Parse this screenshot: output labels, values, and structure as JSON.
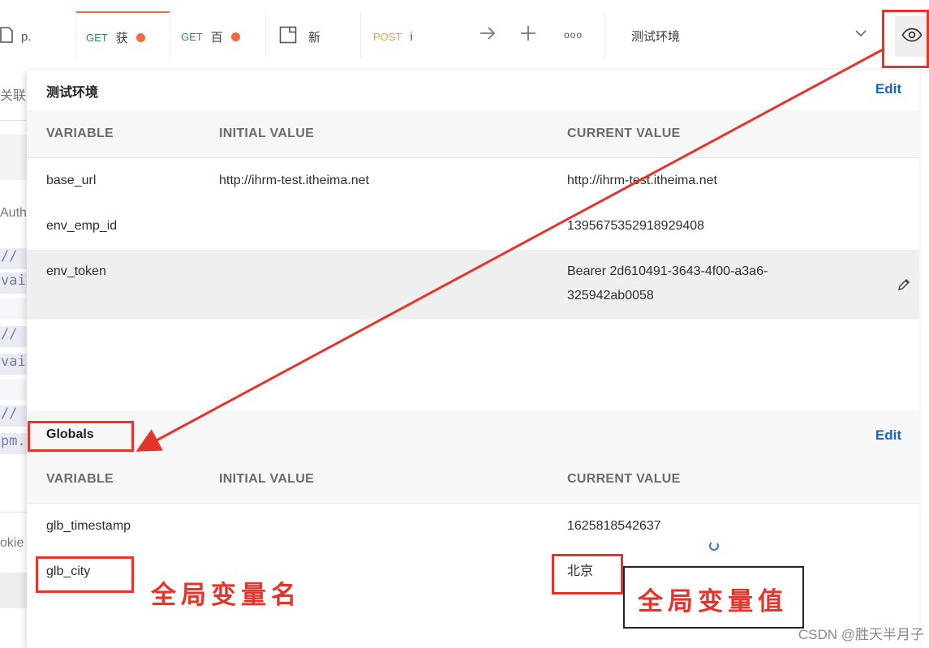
{
  "tabs": [
    {
      "method": "",
      "title": "p.",
      "unsaved": false
    },
    {
      "method": "GET",
      "title": "获",
      "unsaved": true
    },
    {
      "method": "GET",
      "title": "百",
      "unsaved": true
    },
    {
      "method": "",
      "title": "新",
      "unsaved": false
    },
    {
      "method": "POST",
      "title": "i",
      "unsaved": false
    }
  ],
  "toolbar": {
    "more_icon": "ooo"
  },
  "environment": {
    "selected": "测试环境"
  },
  "left_strip": {
    "items": [
      "关联",
      "Auth",
      "//",
      "vai",
      "//",
      "vai",
      "//",
      "pm.",
      "okie"
    ]
  },
  "env_section": {
    "title": "测试环境",
    "edit_label": "Edit",
    "col_variable": "VARIABLE",
    "col_initial": "INITIAL VALUE",
    "col_current": "CURRENT VALUE",
    "rows": [
      {
        "variable": "base_url",
        "initial": "http://ihrm-test.itheima.net",
        "current": "http://ihrm-test.itheima.net"
      },
      {
        "variable": "env_emp_id",
        "initial": "",
        "current": "1395675352918929408"
      },
      {
        "variable": "env_token",
        "initial": "",
        "current_line1": "Bearer 2d610491-3643-4f00-a3a6-",
        "current_line2": "325942ab0058"
      }
    ]
  },
  "globals_section": {
    "title": "Globals",
    "edit_label": "Edit",
    "col_variable": "VARIABLE",
    "col_initial": "INITIAL VALUE",
    "col_current": "CURRENT VALUE",
    "rows": [
      {
        "variable": "glb_timestamp",
        "initial": "",
        "current": "1625818542637"
      },
      {
        "variable": "glb_city",
        "initial": "",
        "current": "北京"
      }
    ]
  },
  "annotations": {
    "var_name_label": "全局变量名",
    "var_value_label": "全局变量值"
  },
  "watermark": "CSDN @胜天半月子",
  "colors": {
    "accent": "#f26b3a",
    "link": "#1a64c8",
    "annotation": "#e5352b"
  }
}
